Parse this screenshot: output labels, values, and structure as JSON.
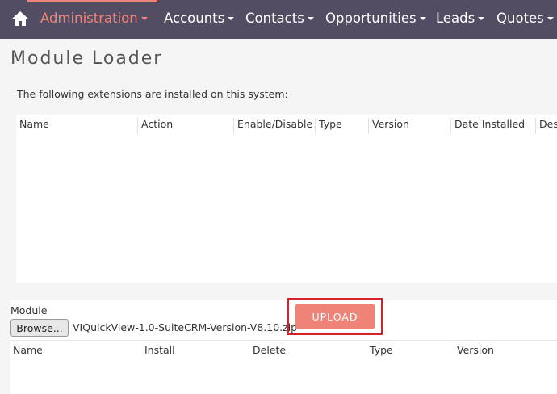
{
  "navbar": {
    "home_icon": "home-icon",
    "brand_bg": "#534d64",
    "accent": "#f08377",
    "items": [
      {
        "label": "Administration",
        "active": true
      },
      {
        "label": "Accounts"
      },
      {
        "label": "Contacts"
      },
      {
        "label": "Opportunities"
      },
      {
        "label": "Leads"
      },
      {
        "label": "Quotes"
      }
    ]
  },
  "page": {
    "title": "Module Loader",
    "intro": "The following extensions are installed on this system:"
  },
  "installed_table": {
    "columns": [
      "Name",
      "Action",
      "Enable/Disable",
      "Type",
      "Version",
      "Date Installed",
      "Description"
    ],
    "rows": []
  },
  "upload": {
    "module_label": "Module",
    "browse_label": "Browse...",
    "file_name": "VIQuickView-1.0-SuiteCRM-Version-V8.10.zip",
    "upload_label": "UPLOAD"
  },
  "uploaded_table": {
    "columns": [
      "Name",
      "Install",
      "Delete",
      "Type",
      "Version"
    ]
  }
}
